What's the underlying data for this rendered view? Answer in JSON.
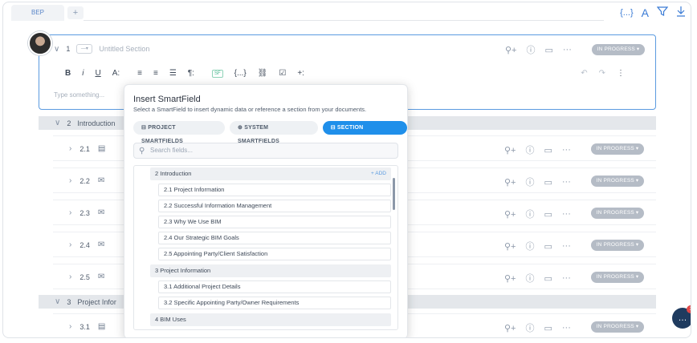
{
  "tabbar": {
    "tab_label": "BEP",
    "add_tab": "+"
  },
  "toolbar_top": {
    "bind_icon": "{...}",
    "font_icon": "A",
    "filter_icon": "filter",
    "download_icon": "download"
  },
  "section1": {
    "number": "1",
    "selector": "—▾",
    "title": "Untitled Section",
    "placeholder": "Type something...",
    "status": "IN PROGRESS ▾",
    "format": {
      "bold": "B",
      "italic": "i",
      "underline": "U",
      "size": "A:",
      "align_left": "≡",
      "align_center": "≡",
      "list": "☰",
      "para": "¶:",
      "smartfield": "SF",
      "bind": "{...}",
      "link": "⛓",
      "check": "☑",
      "insert": "+:"
    },
    "undo": "↶",
    "redo": "↷",
    "more": "⋮"
  },
  "sections": [
    {
      "number": "2",
      "title": "Introduction"
    },
    {
      "number": "3",
      "title": "Project Infor"
    }
  ],
  "subsections": [
    {
      "number": "2.1",
      "icon": "doc-icon",
      "glyph": "▤",
      "status": "IN PROGRESS ▾"
    },
    {
      "number": "2.2",
      "icon": "megaphone-icon",
      "glyph": "📢",
      "status": "IN PROGRESS ▾"
    },
    {
      "number": "2.3",
      "icon": "megaphone-icon",
      "glyph": "📢",
      "status": "IN PROGRESS ▾"
    },
    {
      "number": "2.4",
      "icon": "megaphone-icon",
      "glyph": "📢",
      "status": "IN PROGRESS ▾"
    },
    {
      "number": "2.5",
      "icon": "megaphone-icon",
      "glyph": "📢",
      "status": "IN PROGRESS ▾"
    },
    {
      "number": "3.1",
      "icon": "doc-icon",
      "glyph": "▤",
      "status": "IN PROGRESS ▾"
    }
  ],
  "row_actions": {
    "assign": "⚲+",
    "info": "ⓘ",
    "comment": "▭",
    "more": "···"
  },
  "help": {
    "badge": "1"
  },
  "popup": {
    "title": "Insert SmartField",
    "subtitle": "Select a SmartField to insert dynamic data or reference a section from your documents.",
    "tabs": [
      {
        "label": "⊟ PROJECT SMARTFIELDS",
        "active": false
      },
      {
        "label": "⊕ SYSTEM SMARTFIELDS",
        "active": false
      },
      {
        "label": "⊟ SECTION REFERENCE",
        "active": true
      }
    ],
    "search_placeholder": "Search fields...",
    "add_label": "+ ADD",
    "items": [
      {
        "label": "2 Introduction",
        "type": "group"
      },
      {
        "label": "2.1 Project Information",
        "type": "item"
      },
      {
        "label": "2.2 Successful Information Management",
        "type": "item"
      },
      {
        "label": "2.3 Why We Use BIM",
        "type": "item"
      },
      {
        "label": "2.4 Our Strategic BIM Goals",
        "type": "item"
      },
      {
        "label": "2.5 Appointing Party/Client Satisfaction",
        "type": "item"
      },
      {
        "label": "3 Project Information",
        "type": "group"
      },
      {
        "label": "3.1 Additional Project Details",
        "type": "item"
      },
      {
        "label": "3.2 Specific Appointing Party/Owner Requirements",
        "type": "item"
      },
      {
        "label": "4 BIM Uses",
        "type": "group"
      }
    ]
  },
  "colors": {
    "accent": "#1f8fea",
    "focus_border": "#5b9be0",
    "status_bg": "#b5bcc6",
    "help_bg": "#1f3b5f"
  }
}
